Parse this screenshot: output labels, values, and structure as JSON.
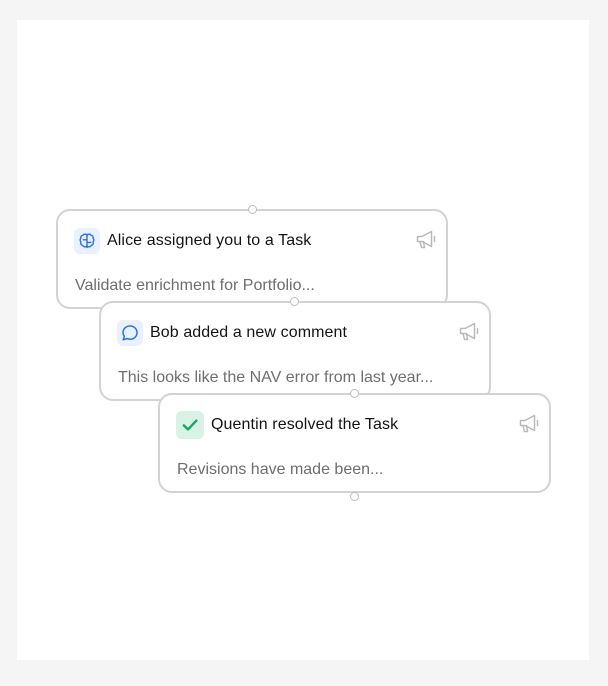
{
  "notifications": [
    {
      "icon": "brain-icon",
      "title": "Alice assigned you to a Task",
      "description": "Validate enrichment for Portfolio..."
    },
    {
      "icon": "chat-bubble-icon",
      "title": "Bob added a new comment",
      "description": "This looks like the NAV error from last year..."
    },
    {
      "icon": "checkmark-icon",
      "title": "Quentin resolved the Task",
      "description": "Revisions have made been..."
    }
  ],
  "colors": {
    "accent_blue": "#2f6fe4",
    "accent_green": "#1aa567",
    "card_border": "#d3d3d3"
  }
}
